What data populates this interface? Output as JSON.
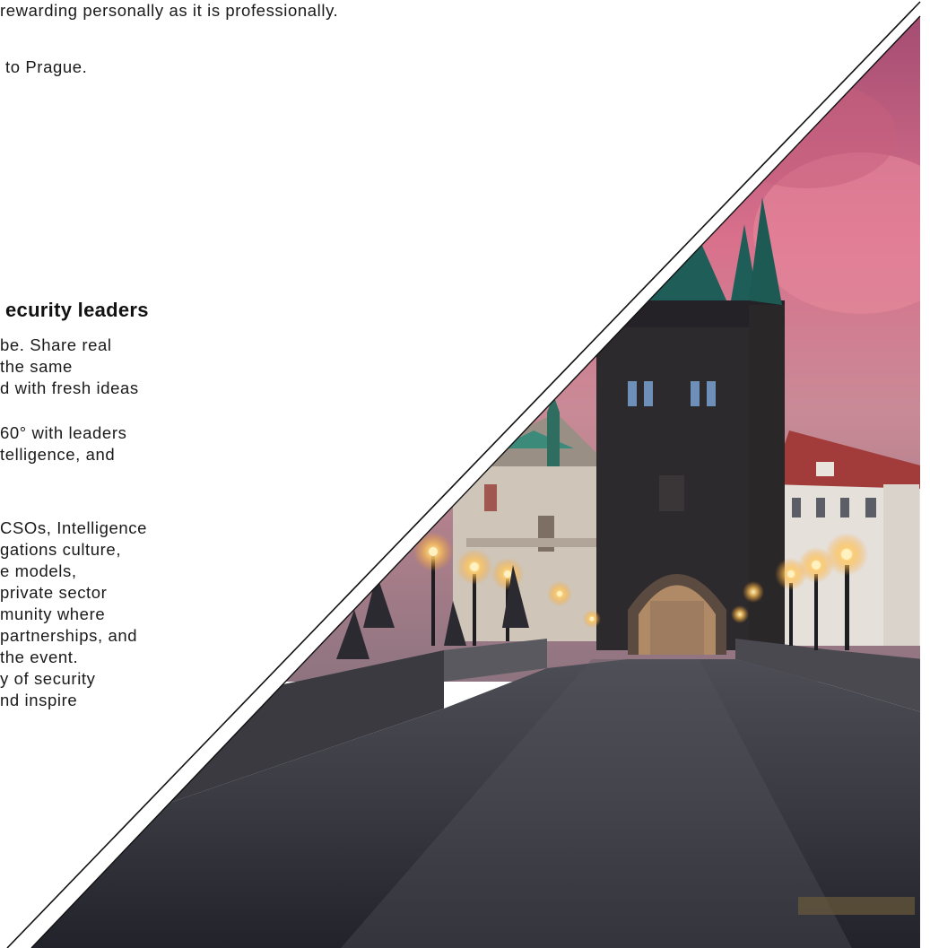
{
  "intro": {
    "line1": "rewarding personally as it is professionally.",
    "line2": "to Prague."
  },
  "section": {
    "heading": "ecurity leaders",
    "para1": [
      "be. Share real",
      "the same",
      "d with fresh ideas"
    ],
    "para2": [
      "60° with leaders",
      "telligence, and"
    ],
    "para3": [
      "CSOs, Intelligence",
      "gations culture,",
      "e models,",
      "private sector",
      "munity where",
      "partnerships, and",
      "the event.",
      "y of security",
      "nd inspire"
    ]
  },
  "image": {
    "subject": "prague-charles-bridge-tower-dusk-photo",
    "sky_top": "#b25a78",
    "sky_pink": "#e88a9e",
    "tower": "#2c2a2e",
    "roof_green": "#1f6b5c",
    "pavement": "#3a3b45",
    "lamp": "#ffd27a",
    "divider": "#111111"
  }
}
